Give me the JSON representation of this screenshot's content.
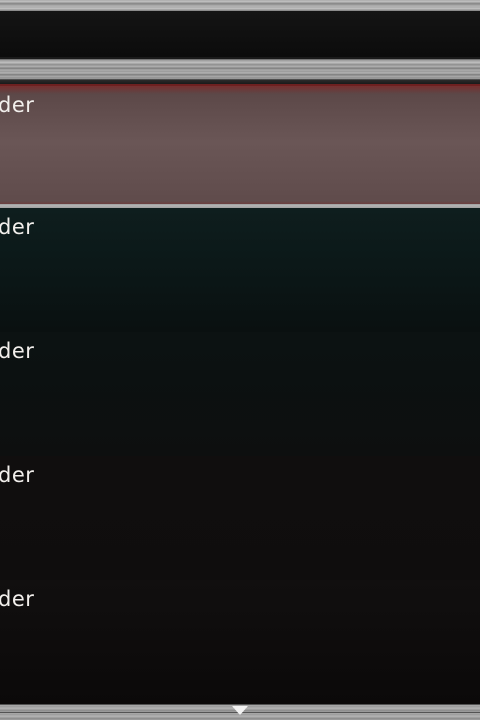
{
  "list": {
    "items": [
      {
        "label": "der",
        "selected": true
      },
      {
        "label": "der",
        "selected": false
      },
      {
        "label": "der",
        "selected": false
      },
      {
        "label": "der",
        "selected": false
      },
      {
        "label": "der",
        "selected": false
      }
    ]
  },
  "icons": {
    "scroll_down": "triangle-down-icon"
  },
  "colors": {
    "selected_highlight": "#6a5656",
    "selected_edge": "#8c1e1e",
    "background": "#0b0a0a",
    "text": "#f2efec"
  }
}
